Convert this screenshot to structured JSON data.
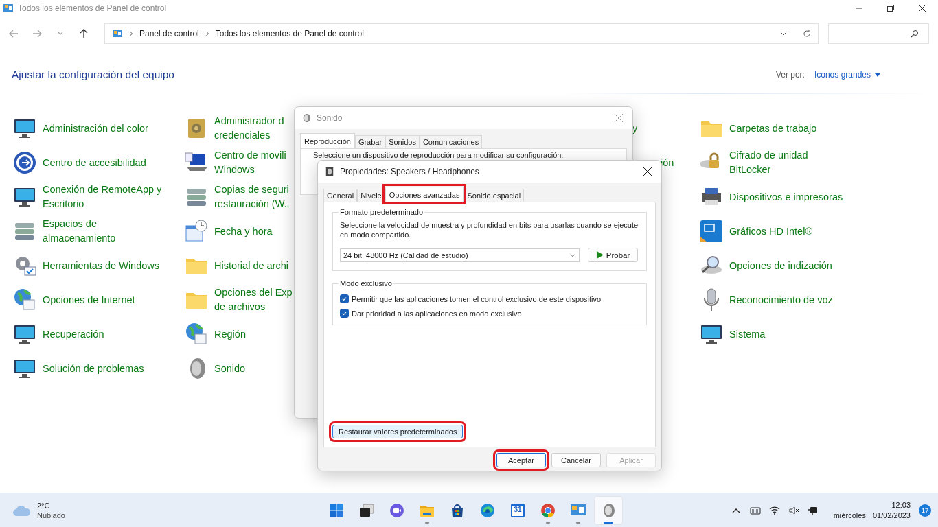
{
  "window": {
    "title": "Todos los elementos de Panel de control"
  },
  "nav_buttons": [
    {
      "disabled": true
    },
    {
      "disabled": true
    },
    {
      "disabled": true
    },
    {
      "disabled": false
    }
  ],
  "address_bar": {
    "crumbs": [
      "Panel de control",
      "Todos los elementos de Panel de control"
    ]
  },
  "heading": "Ajustar la configuración del equipo",
  "view_by": {
    "label": "Ver por:",
    "value": "Iconos grandes"
  },
  "columns": [
    [
      {
        "lines": [
          "Administración del color"
        ]
      },
      {
        "lines": [
          "Centro de accesibilidad"
        ]
      },
      {
        "lines": [
          "Conexión de RemoteApp y",
          "Escritorio"
        ]
      },
      {
        "lines": [
          "Espacios de",
          "almacenamiento"
        ]
      },
      {
        "lines": [
          "Herramientas de Windows"
        ]
      },
      {
        "lines": [
          "Opciones de Internet"
        ]
      },
      {
        "lines": [
          "Recuperación"
        ]
      },
      {
        "lines": [
          "Solución de problemas"
        ]
      }
    ],
    [
      {
        "lines": [
          "Administrador d",
          "credenciales"
        ]
      },
      {
        "lines": [
          "Centro de movili",
          "Windows"
        ]
      },
      {
        "lines": [
          "Copias de seguri",
          "restauración (W.."
        ]
      },
      {
        "lines": [
          "Fecha y hora"
        ]
      },
      {
        "lines": [
          "Historial de archi"
        ]
      },
      {
        "lines": [
          "Opciones del Exp",
          "de archivos"
        ]
      },
      {
        "lines": [
          "Región"
        ]
      },
      {
        "lines": [
          "Sonido"
        ]
      }
    ],
    [
      {
        "lines": [
          "y"
        ]
      },
      {
        "lines": [
          "ión"
        ]
      }
    ],
    [
      {
        "lines": [
          "Carpetas de trabajo"
        ]
      },
      {
        "lines": [
          "Cifrado de unidad",
          "BitLocker"
        ]
      },
      {
        "lines": [
          "Dispositivos e impresoras"
        ]
      },
      {
        "lines": [
          "Gráficos HD Intel®"
        ]
      },
      {
        "lines": [
          "Opciones de indización"
        ]
      },
      {
        "lines": [
          "Reconocimiento de voz"
        ]
      },
      {
        "lines": [
          "Sistema"
        ]
      }
    ]
  ],
  "sound_dialog": {
    "title": "Sonido",
    "tabs": [
      {
        "label": "Reproducción",
        "selected": true
      },
      {
        "label": "Grabar",
        "selected": false
      },
      {
        "label": "Sonidos",
        "selected": false
      },
      {
        "label": "Comunicaciones",
        "selected": false
      }
    ],
    "prompt": "Seleccione un dispositivo de reproducción para modificar su configuración:"
  },
  "properties_dialog": {
    "title": "Propiedades: Speakers / Headphones",
    "tabs": [
      {
        "label": "General",
        "selected": false,
        "highlighted": false
      },
      {
        "label": "Nivele",
        "selected": false,
        "highlighted": false
      },
      {
        "label": "Opciones avanzadas",
        "selected": true,
        "highlighted": true
      },
      {
        "label": "Sonido espacial",
        "selected": false,
        "highlighted": false
      }
    ],
    "format_group": {
      "title": "Formato predeterminado",
      "description": "Seleccione la velocidad de muestra y profundidad en bits para usarlas cuando se ejecute en modo compartido.",
      "value": "24 bit, 48000 Hz (Calidad de estudio)",
      "test_button": "Probar"
    },
    "exclusive_group": {
      "title": "Modo exclusivo",
      "options": [
        {
          "label": "Permitir que las aplicaciones tomen el control exclusivo de este dispositivo",
          "checked": true
        },
        {
          "label": "Dar prioridad a las aplicaciones en modo exclusivo",
          "checked": true
        }
      ]
    },
    "restore_button": {
      "label": "Restaurar valores predeterminados",
      "highlighted": true
    },
    "buttons": [
      {
        "label": "Aceptar",
        "default": true,
        "highlighted": true,
        "disabled": false
      },
      {
        "label": "Cancelar",
        "default": false,
        "highlighted": false,
        "disabled": false
      },
      {
        "label": "Aplicar",
        "default": false,
        "highlighted": false,
        "disabled": true
      }
    ]
  },
  "taskbar": {
    "weather": {
      "temperature": "2°C",
      "condition": "Nublado"
    },
    "apps": [
      {
        "running": false,
        "active": false
      },
      {
        "running": false,
        "active": false
      },
      {
        "running": false,
        "active": false
      },
      {
        "running": true,
        "active": false
      },
      {
        "running": false,
        "active": false
      },
      {
        "running": false,
        "active": false
      },
      {
        "running": false,
        "active": false,
        "label": "31"
      },
      {
        "running": true,
        "active": false
      },
      {
        "running": true,
        "active": false
      },
      {
        "running": true,
        "active": true
      }
    ],
    "clock": {
      "time": "12:03",
      "day": "miércoles",
      "date": "01/02/2023"
    },
    "notifications": "17"
  }
}
